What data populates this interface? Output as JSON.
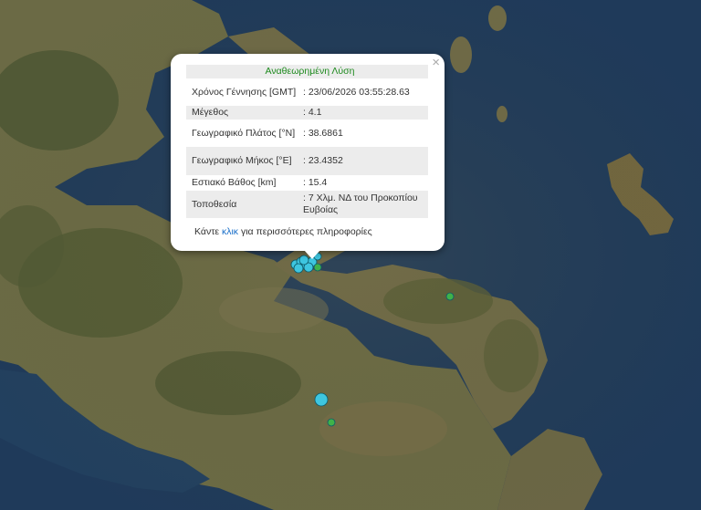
{
  "map": {
    "colors": {
      "sea": "#1f3a5a",
      "land": "#6e6a45",
      "land_dark": "#4e5530",
      "recent_marker": "#3ec6e0",
      "older_marker": "#3fb24a"
    },
    "markers": [
      {
        "kind": "recent"
      },
      {
        "kind": "recent"
      },
      {
        "kind": "recent"
      },
      {
        "kind": "recent"
      },
      {
        "kind": "recent"
      },
      {
        "kind": "recent"
      },
      {
        "kind": "recent"
      },
      {
        "kind": "recent"
      },
      {
        "kind": "recent"
      },
      {
        "kind": "older"
      },
      {
        "kind": "older"
      },
      {
        "kind": "older"
      }
    ]
  },
  "popup": {
    "header": "Αναθεωρημένη Λύση",
    "close_icon": "×",
    "rows": [
      {
        "label": "Χρόνος Γέννησης [GMT]",
        "value": ": 23/06/2026 03:55:28.63"
      },
      {
        "label": "Μέγεθος",
        "value": ": 4.1"
      },
      {
        "label": "Γεωγραφικό Πλάτος [°N]",
        "value": ": 38.6861"
      },
      {
        "label": "Γεωγραφικό Μήκος [°E]",
        "value": ": 23.4352"
      },
      {
        "label": "Εστιακό Βάθος [km]",
        "value": ": 15.4"
      },
      {
        "label": "Τοποθεσία",
        "value": ": 7 Χλμ. ΝΔ του Προκοπίου Ευβοίας"
      }
    ],
    "more_prefix": "Κάντε ",
    "more_link": "κλικ",
    "more_suffix": " για περισσότερες πληροφορίες"
  }
}
